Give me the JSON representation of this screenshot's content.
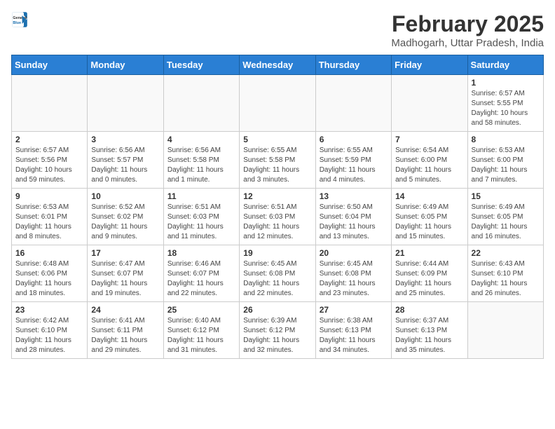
{
  "logo": {
    "line1": "General",
    "line2": "Blue"
  },
  "title": "February 2025",
  "location": "Madhogarh, Uttar Pradesh, India",
  "weekdays": [
    "Sunday",
    "Monday",
    "Tuesday",
    "Wednesday",
    "Thursday",
    "Friday",
    "Saturday"
  ],
  "weeks": [
    [
      {
        "day": "",
        "info": ""
      },
      {
        "day": "",
        "info": ""
      },
      {
        "day": "",
        "info": ""
      },
      {
        "day": "",
        "info": ""
      },
      {
        "day": "",
        "info": ""
      },
      {
        "day": "",
        "info": ""
      },
      {
        "day": "1",
        "info": "Sunrise: 6:57 AM\nSunset: 5:55 PM\nDaylight: 10 hours\nand 58 minutes."
      }
    ],
    [
      {
        "day": "2",
        "info": "Sunrise: 6:57 AM\nSunset: 5:56 PM\nDaylight: 10 hours\nand 59 minutes."
      },
      {
        "day": "3",
        "info": "Sunrise: 6:56 AM\nSunset: 5:57 PM\nDaylight: 11 hours\nand 0 minutes."
      },
      {
        "day": "4",
        "info": "Sunrise: 6:56 AM\nSunset: 5:58 PM\nDaylight: 11 hours\nand 1 minute."
      },
      {
        "day": "5",
        "info": "Sunrise: 6:55 AM\nSunset: 5:58 PM\nDaylight: 11 hours\nand 3 minutes."
      },
      {
        "day": "6",
        "info": "Sunrise: 6:55 AM\nSunset: 5:59 PM\nDaylight: 11 hours\nand 4 minutes."
      },
      {
        "day": "7",
        "info": "Sunrise: 6:54 AM\nSunset: 6:00 PM\nDaylight: 11 hours\nand 5 minutes."
      },
      {
        "day": "8",
        "info": "Sunrise: 6:53 AM\nSunset: 6:00 PM\nDaylight: 11 hours\nand 7 minutes."
      }
    ],
    [
      {
        "day": "9",
        "info": "Sunrise: 6:53 AM\nSunset: 6:01 PM\nDaylight: 11 hours\nand 8 minutes."
      },
      {
        "day": "10",
        "info": "Sunrise: 6:52 AM\nSunset: 6:02 PM\nDaylight: 11 hours\nand 9 minutes."
      },
      {
        "day": "11",
        "info": "Sunrise: 6:51 AM\nSunset: 6:03 PM\nDaylight: 11 hours\nand 11 minutes."
      },
      {
        "day": "12",
        "info": "Sunrise: 6:51 AM\nSunset: 6:03 PM\nDaylight: 11 hours\nand 12 minutes."
      },
      {
        "day": "13",
        "info": "Sunrise: 6:50 AM\nSunset: 6:04 PM\nDaylight: 11 hours\nand 13 minutes."
      },
      {
        "day": "14",
        "info": "Sunrise: 6:49 AM\nSunset: 6:05 PM\nDaylight: 11 hours\nand 15 minutes."
      },
      {
        "day": "15",
        "info": "Sunrise: 6:49 AM\nSunset: 6:05 PM\nDaylight: 11 hours\nand 16 minutes."
      }
    ],
    [
      {
        "day": "16",
        "info": "Sunrise: 6:48 AM\nSunset: 6:06 PM\nDaylight: 11 hours\nand 18 minutes."
      },
      {
        "day": "17",
        "info": "Sunrise: 6:47 AM\nSunset: 6:07 PM\nDaylight: 11 hours\nand 19 minutes."
      },
      {
        "day": "18",
        "info": "Sunrise: 6:46 AM\nSunset: 6:07 PM\nDaylight: 11 hours\nand 22 minutes."
      },
      {
        "day": "19",
        "info": "Sunrise: 6:45 AM\nSunset: 6:08 PM\nDaylight: 11 hours\nand 22 minutes."
      },
      {
        "day": "20",
        "info": "Sunrise: 6:45 AM\nSunset: 6:08 PM\nDaylight: 11 hours\nand 23 minutes."
      },
      {
        "day": "21",
        "info": "Sunrise: 6:44 AM\nSunset: 6:09 PM\nDaylight: 11 hours\nand 25 minutes."
      },
      {
        "day": "22",
        "info": "Sunrise: 6:43 AM\nSunset: 6:10 PM\nDaylight: 11 hours\nand 26 minutes."
      }
    ],
    [
      {
        "day": "23",
        "info": "Sunrise: 6:42 AM\nSunset: 6:10 PM\nDaylight: 11 hours\nand 28 minutes."
      },
      {
        "day": "24",
        "info": "Sunrise: 6:41 AM\nSunset: 6:11 PM\nDaylight: 11 hours\nand 29 minutes."
      },
      {
        "day": "25",
        "info": "Sunrise: 6:40 AM\nSunset: 6:12 PM\nDaylight: 11 hours\nand 31 minutes."
      },
      {
        "day": "26",
        "info": "Sunrise: 6:39 AM\nSunset: 6:12 PM\nDaylight: 11 hours\nand 32 minutes."
      },
      {
        "day": "27",
        "info": "Sunrise: 6:38 AM\nSunset: 6:13 PM\nDaylight: 11 hours\nand 34 minutes."
      },
      {
        "day": "28",
        "info": "Sunrise: 6:37 AM\nSunset: 6:13 PM\nDaylight: 11 hours\nand 35 minutes."
      },
      {
        "day": "",
        "info": ""
      }
    ]
  ]
}
